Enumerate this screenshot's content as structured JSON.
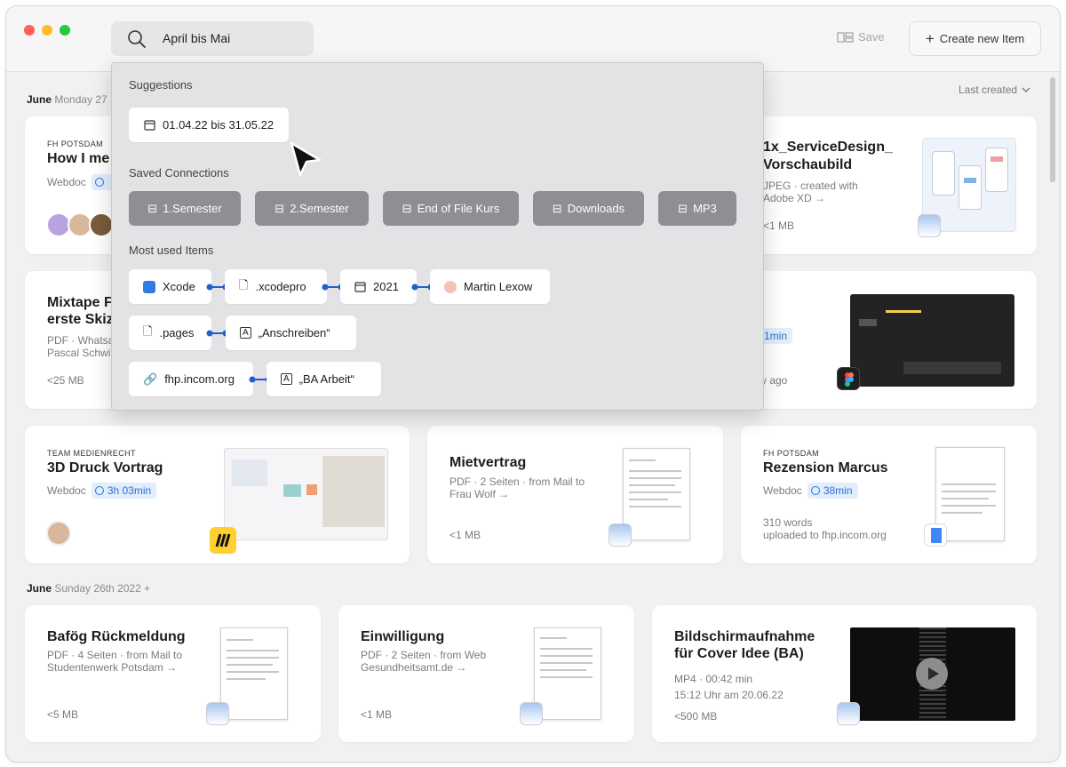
{
  "toolbar": {
    "search_value": "April bis Mai",
    "save_label": "Save",
    "create_label": "Create new Item",
    "sort_label": "Last created"
  },
  "sections": [
    {
      "month": "June",
      "rest": "Monday 27"
    },
    {
      "month": "June",
      "rest": "Sunday 26th 2022 +"
    }
  ],
  "cards": {
    "c1": {
      "eyebrow": "FH POTSDAM",
      "title": "How I me",
      "type": "Webdoc"
    },
    "c2": {
      "title": "1x_ServiceDesign_",
      "title2": "Vorschaubild",
      "meta": "JPEG · created with",
      "meta2": "Adobe XD →",
      "size": "<1 MB"
    },
    "c3": {
      "title": "Mixtape F",
      "title2": "erste Skiz",
      "meta": "PDF · Whatsa",
      "meta2": "Pascal Schwi",
      "size": "<25 MB"
    },
    "c4": {
      "duration": "1min",
      "ago": "y ago"
    },
    "c5": {
      "eyebrow": "TEAM MEDIENRECHT",
      "title": "3D Druck Vortrag",
      "type": "Webdoc",
      "duration": "3h 03min"
    },
    "c6": {
      "title": "Mietvertrag",
      "meta": "PDF · 2 Seiten · from Mail to",
      "meta2": "Frau Wolf →",
      "size": "<1 MB"
    },
    "c7": {
      "eyebrow": "FH POTSDAM",
      "title": "Rezension Marcus",
      "type": "Webdoc",
      "duration": "38min",
      "words": "310 words",
      "uploaded": "uploaded to fhp.incom.org"
    },
    "c8": {
      "title": "Bafög Rückmeldung",
      "meta": "PDF · 4 Seiten · from Mail to",
      "meta2": "Studentenwerk Potsdam →",
      "size": "<5 MB"
    },
    "c9": {
      "title": "Einwilligung",
      "meta": "PDF · 2 Seiten · from Web",
      "meta2": "Gesundheitsamt.de  →",
      "size": "<1 MB"
    },
    "c10": {
      "title": "Bildschirmaufnahme",
      "title2": "für Cover Idee (BA)",
      "meta": "MP4 · 00:42 min",
      "meta2": "15:12 Uhr am 20.06.22",
      "size": "<500 MB"
    }
  },
  "dropdown": {
    "suggestions_heading": "Suggestions",
    "suggestion": "01.04.22 bis 31.05.22",
    "saved_heading": "Saved Connections",
    "saved": [
      "1.Semester",
      "2.Semester",
      "End of File Kurs",
      "Downloads",
      "MP3"
    ],
    "most_used_heading": "Most used Items",
    "row1": [
      "Xcode",
      ".xcodepro",
      "2021",
      "Martin Lexow"
    ],
    "row2": [
      ".pages",
      "„Anschreiben“"
    ],
    "row3": [
      "fhp.incom.org",
      "„BA Arbeit“"
    ]
  },
  "colors": {
    "accent": "#2a6fd6",
    "chip_gray": "#8e8e93",
    "link_blue": "#1f5fd0"
  }
}
